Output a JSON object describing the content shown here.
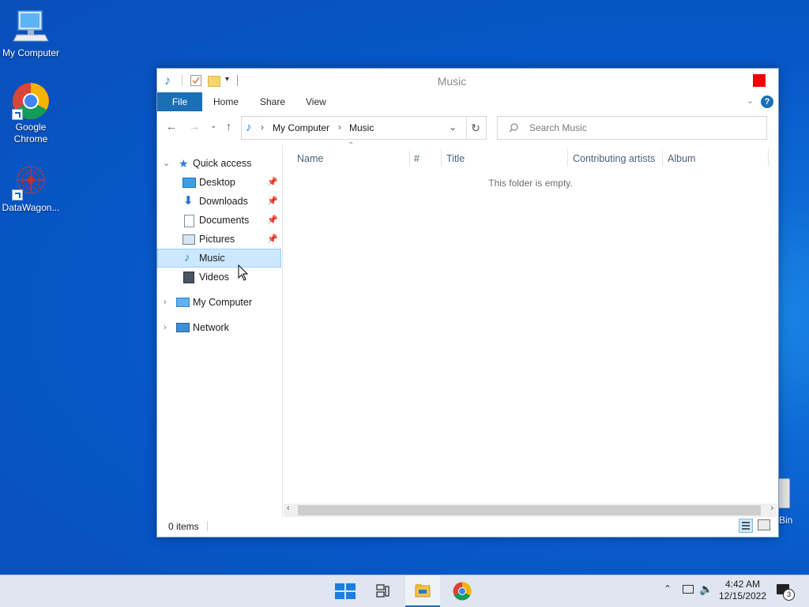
{
  "desktop": {
    "icons": [
      {
        "label": "My Computer"
      },
      {
        "label": "Google Chrome"
      },
      {
        "label": "DataWagon..."
      }
    ],
    "partial_icon_label": "Bin"
  },
  "window": {
    "title": "Music",
    "ribbon_tabs": [
      "File",
      "Home",
      "Share",
      "View"
    ],
    "address": {
      "root": "My Computer",
      "current": "Music"
    },
    "search": {
      "placeholder": "Search Music"
    },
    "nav": {
      "quick_access": "Quick access",
      "items": [
        {
          "label": "Desktop",
          "icon": "desktop-icon",
          "pinned": true
        },
        {
          "label": "Downloads",
          "icon": "download-icon",
          "pinned": true
        },
        {
          "label": "Documents",
          "icon": "document-icon",
          "pinned": true
        },
        {
          "label": "Pictures",
          "icon": "picture-icon",
          "pinned": true
        },
        {
          "label": "Music",
          "icon": "music-icon",
          "pinned": false,
          "selected": true
        },
        {
          "label": "Videos",
          "icon": "video-icon",
          "pinned": false
        }
      ],
      "my_computer": "My Computer",
      "network": "Network"
    },
    "columns": [
      "Name",
      "#",
      "Title",
      "Contributing artists",
      "Album"
    ],
    "empty_message": "This folder is empty.",
    "status": "0 items"
  },
  "taskbar": {
    "time": "4:42 AM",
    "date": "12/15/2022",
    "notification_count": "3"
  },
  "colors": {
    "accent": "#1a6fb8",
    "close": "#f10000",
    "selection": "#cce8ff"
  }
}
